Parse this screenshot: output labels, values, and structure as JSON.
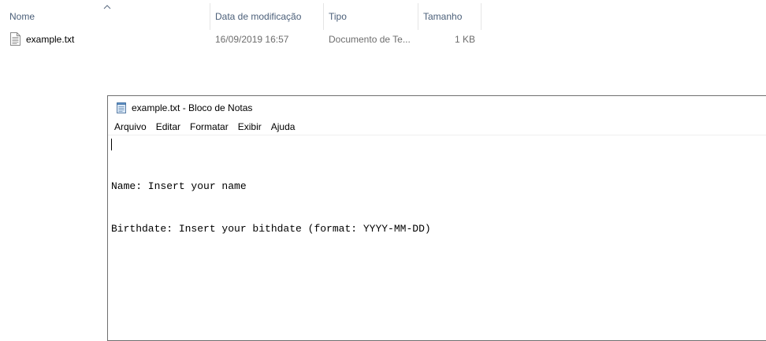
{
  "explorer": {
    "columns": {
      "name": "Nome",
      "date": "Data de modificação",
      "type": "Tipo",
      "size": "Tamanho"
    },
    "sort_icon": "chevron-up-icon",
    "files": [
      {
        "icon": "text-file-icon",
        "name": "example.txt",
        "modified": "16/09/2019 16:57",
        "type": "Documento de Te...",
        "size": "1 KB"
      }
    ]
  },
  "notepad": {
    "icon": "notepad-icon",
    "title": "example.txt - Bloco de Notas",
    "menu": [
      "Arquivo",
      "Editar",
      "Formatar",
      "Exibir",
      "Ajuda"
    ],
    "lines": [
      "Name: Insert your name",
      "Birthdate: Insert your bithdate (format: YYYY-MM-DD)"
    ]
  }
}
